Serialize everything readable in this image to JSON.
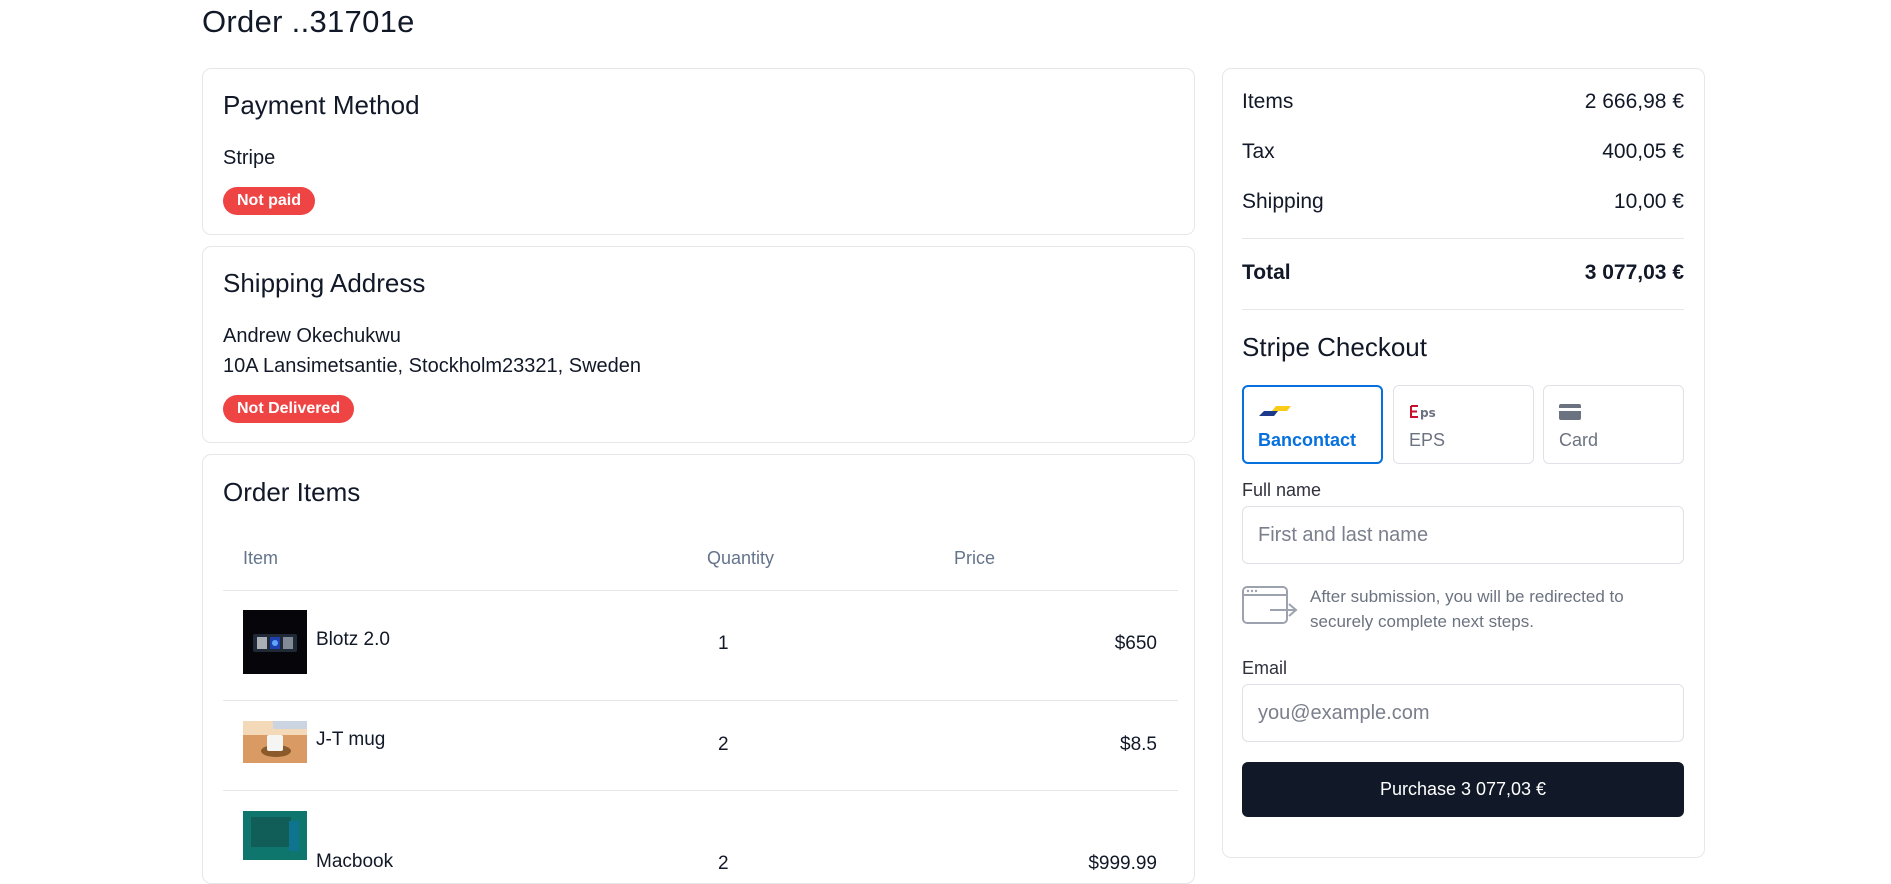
{
  "page": {
    "title": "Order ..31701e"
  },
  "payment_method": {
    "heading": "Payment Method",
    "method": "Stripe",
    "status": "Not paid"
  },
  "shipping": {
    "heading": "Shipping Address",
    "name": "Andrew Okechukwu",
    "address": "10A Lansimetsantie, Stockholm23321, Sweden",
    "status": "Not Delivered"
  },
  "order_items": {
    "heading": "Order Items",
    "columns": [
      "Item",
      "Quantity",
      "Price"
    ],
    "rows": [
      {
        "name": "Blotz 2.0",
        "quantity": "1",
        "price": "$650"
      },
      {
        "name": "J-T mug",
        "quantity": "2",
        "price": "$8.5"
      },
      {
        "name": "Macbook",
        "quantity": "2",
        "price": "$999.99"
      }
    ]
  },
  "summary": {
    "items_label": "Items",
    "items_value": "2 666,98 €",
    "tax_label": "Tax",
    "tax_value": "400,05 €",
    "shipping_label": "Shipping",
    "shipping_value": "10,00 €",
    "total_label": "Total",
    "total_value": "3 077,03 €"
  },
  "checkout": {
    "heading": "Stripe Checkout",
    "methods": [
      {
        "label": "Bancontact",
        "icon": "bancontact-icon",
        "active": true
      },
      {
        "label": "EPS",
        "icon": "eps-icon",
        "active": false
      },
      {
        "label": "Card",
        "icon": "card-icon",
        "active": false
      }
    ],
    "full_name_label": "Full name",
    "full_name_placeholder": "First and last name",
    "redirect_note": "After submission, you will be redirected to securely complete next steps.",
    "email_label": "Email",
    "email_placeholder": "you@example.com",
    "purchase_button": "Purchase 3 077,03 €"
  },
  "colors": {
    "badge_red": "#ef4444",
    "accent_blue": "#0570de",
    "button_dark": "#111827",
    "border": "#e5e7eb"
  }
}
